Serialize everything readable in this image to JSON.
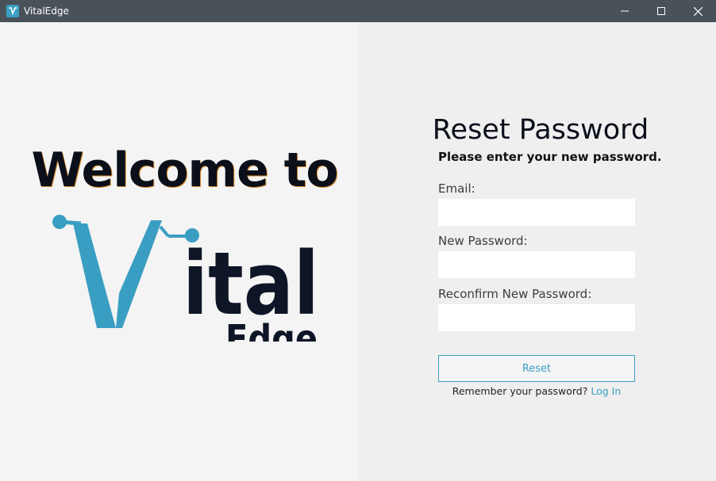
{
  "window": {
    "title": "VitalEdge",
    "controls": [
      "minimize-icon",
      "maximize-icon",
      "close-icon"
    ]
  },
  "left": {
    "welcome_text": "Welcome to",
    "logo": {
      "word_main": "ital",
      "word_sub": "Edge",
      "accent_color": "#3a9ec2",
      "dark_color": "#0d1526"
    }
  },
  "form": {
    "title": "Reset Password",
    "subtitle": "Please enter your new password.",
    "email_label": "Email:",
    "email_value": "",
    "new_password_label": "New Password:",
    "new_password_value": "",
    "reconfirm_label": "Reconfirm New Password:",
    "reconfirm_value": "",
    "reset_button": "Reset",
    "remember_text": "Remember your password?",
    "login_link": "Log In"
  },
  "colors": {
    "titlebar": "#4a5259",
    "accent": "#3a9ec2",
    "left_bg": "#f4f4f4",
    "right_bg": "#efeff0"
  }
}
